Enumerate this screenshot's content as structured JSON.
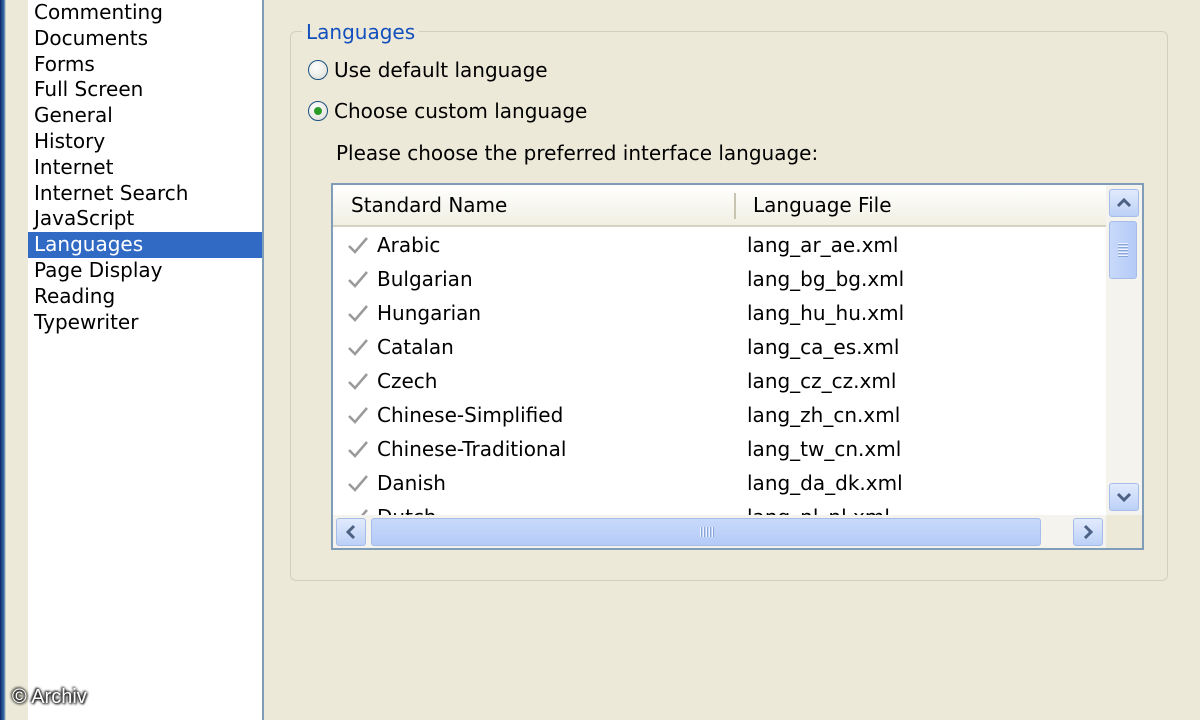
{
  "sidebar": {
    "items": [
      {
        "label": "Commenting"
      },
      {
        "label": "Documents"
      },
      {
        "label": "Forms"
      },
      {
        "label": "Full Screen"
      },
      {
        "label": "General"
      },
      {
        "label": "History"
      },
      {
        "label": "Internet"
      },
      {
        "label": "Internet Search"
      },
      {
        "label": "JavaScript"
      },
      {
        "label": "Languages",
        "selected": true
      },
      {
        "label": "Page Display"
      },
      {
        "label": "Reading"
      },
      {
        "label": "Typewriter"
      }
    ]
  },
  "languages_group": {
    "title": "Languages",
    "option_default": {
      "label": "Use default language",
      "checked": false
    },
    "option_custom": {
      "label": "Choose custom language",
      "checked": true
    },
    "prompt": "Please choose the preferred interface language:"
  },
  "language_list": {
    "columns": [
      "Standard Name",
      "Language File"
    ],
    "rows": [
      {
        "name": "Arabic",
        "file": "lang_ar_ae.xml"
      },
      {
        "name": "Bulgarian",
        "file": "lang_bg_bg.xml"
      },
      {
        "name": "Hungarian",
        "file": "lang_hu_hu.xml"
      },
      {
        "name": "Catalan",
        "file": "lang_ca_es.xml"
      },
      {
        "name": "Czech",
        "file": "lang_cz_cz.xml"
      },
      {
        "name": "Chinese-Simplified",
        "file": "lang_zh_cn.xml"
      },
      {
        "name": "Chinese-Traditional",
        "file": "lang_tw_cn.xml"
      },
      {
        "name": "Danish",
        "file": "lang_da_dk.xml"
      },
      {
        "name": "Dutch",
        "file": "lang_nl_nl.xml"
      }
    ]
  },
  "watermark": "© Archiv",
  "colors": {
    "selection": "#316ac5",
    "group_title": "#1450bd",
    "check": "#9a9a9a"
  }
}
